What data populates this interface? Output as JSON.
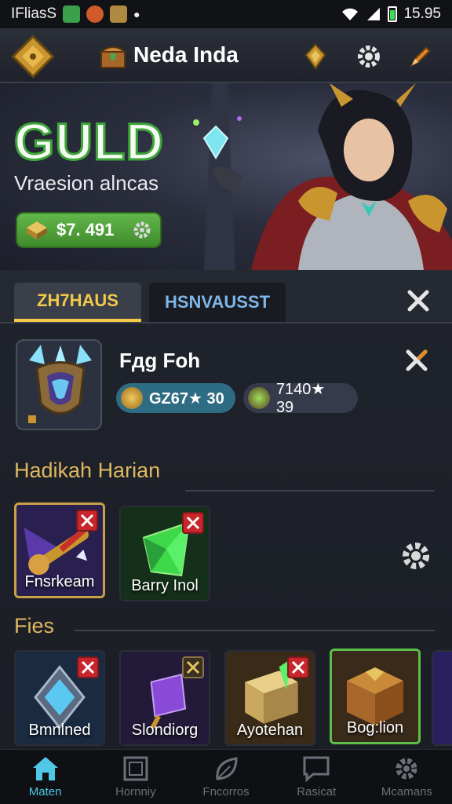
{
  "status_bar": {
    "carrier": "IFliasS",
    "time": "15.95"
  },
  "header": {
    "title": "Neda Inda"
  },
  "hero": {
    "title": "GULD",
    "subtitle": "Vraesion alncas",
    "balance": "$7. 491"
  },
  "tabs": [
    {
      "label": "ZH7HAUS",
      "active": true
    },
    {
      "label": "HSNVAUSST",
      "active": false
    }
  ],
  "profile": {
    "name": "Fдg Foh",
    "stats": [
      {
        "value": "GZ67★ 30"
      },
      {
        "value": "7140★ 39"
      }
    ]
  },
  "daily": {
    "title": "Hadikah Harian",
    "items": [
      {
        "label": "Fnsrkeam"
      },
      {
        "label": "Barry Inol"
      }
    ]
  },
  "files": {
    "title": "Fies",
    "items": [
      {
        "label": "Bmnlned"
      },
      {
        "label": "Slondiorg"
      },
      {
        "label": "Ayotehan"
      },
      {
        "label": "Bog:lion"
      }
    ]
  },
  "nav": [
    {
      "label": "Maten",
      "icon": "home-icon",
      "active": true
    },
    {
      "label": "Hornniy",
      "icon": "frame-icon",
      "active": false
    },
    {
      "label": "Fncorros",
      "icon": "leaf-icon",
      "active": false
    },
    {
      "label": "Rasicat",
      "icon": "chat-icon",
      "active": false
    },
    {
      "label": "Mcamans",
      "icon": "gear-icon",
      "active": false
    }
  ],
  "colors": {
    "accent_gold": "#f3c94a",
    "accent_teal": "#4fc8e6",
    "button_green": "#4f9f38",
    "close_red": "#c9262c"
  }
}
